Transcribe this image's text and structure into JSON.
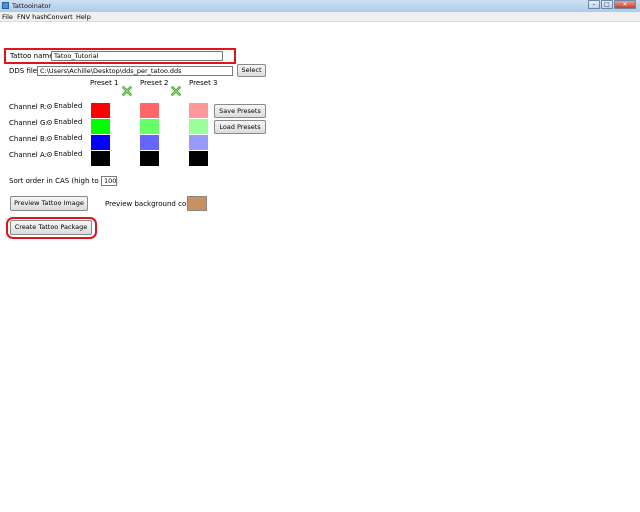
{
  "window": {
    "title": "Tattooinator",
    "minimize_glyph": "–",
    "maximize_glyph": "□",
    "close_glyph": "✕"
  },
  "menu": [
    "File",
    "FNV hash",
    "Convert",
    "Help"
  ],
  "form": {
    "tattoo_name_label": "Tattoo name:",
    "tattoo_name_value": "Tatoo_Tutorial",
    "dds_file_label": "DDS file:",
    "dds_file_value": "C:\\Users\\Achille\\Desktop\\dds_per_tatoo.dds",
    "select_button": "Select"
  },
  "presets": {
    "headers": [
      "Preset 1",
      "Preset 2",
      "Preset 3"
    ],
    "icon": "green-x-icon",
    "columns": [
      [
        "#ff0000",
        "#00ff00",
        "#0000ff",
        "#000000"
      ],
      [
        "#ff6666",
        "#66ff66",
        "#6666ff",
        "#000000"
      ],
      [
        "#ff9999",
        "#99ff99",
        "#9999ff",
        "#000000"
      ]
    ]
  },
  "channels": [
    {
      "label": "Channel R:",
      "option": "Enabled"
    },
    {
      "label": "Channel G:",
      "option": "Enabled"
    },
    {
      "label": "Channel B:",
      "option": "Enabled"
    },
    {
      "label": "Channel A:",
      "option": "Enabled"
    }
  ],
  "buttons": {
    "save_presets": "Save Presets",
    "load_presets": "Load Presets",
    "preview_tattoo": "Preview Tattoo Image",
    "create_package": "Create Tattoo Package"
  },
  "sort": {
    "label": "Sort order in CAS (high to low):",
    "value": "100"
  },
  "preview_bg": {
    "label": "Preview background color:",
    "color": "#c8915e"
  },
  "highlight_color": "#e0141c"
}
